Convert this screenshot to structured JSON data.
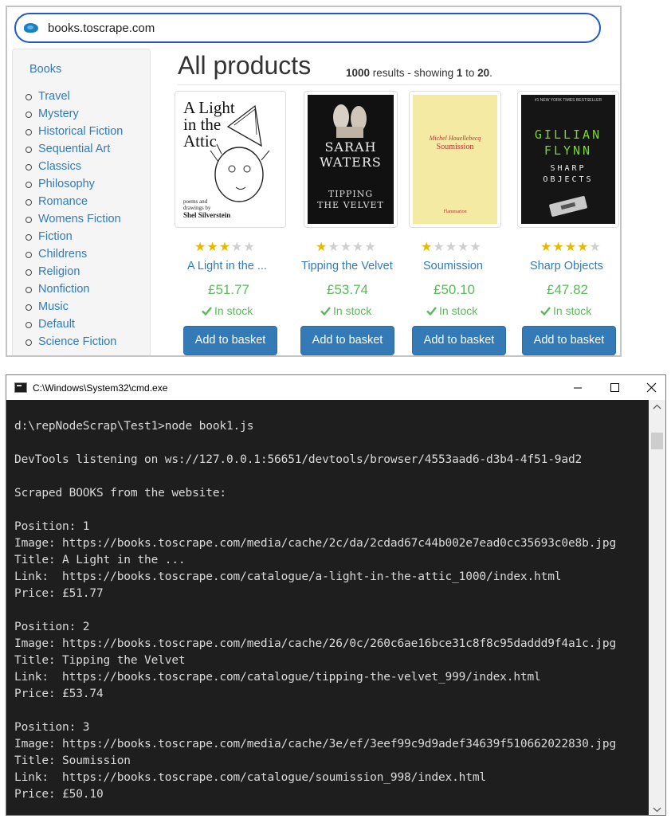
{
  "browser": {
    "url": "books.toscrape.com",
    "sidebar": {
      "title": "Books",
      "categories": [
        "Travel",
        "Mystery",
        "Historical Fiction",
        "Sequential Art",
        "Classics",
        "Philosophy",
        "Romance",
        "Womens Fiction",
        "Fiction",
        "Childrens",
        "Religion",
        "Nonfiction",
        "Music",
        "Default",
        "Science Fiction"
      ]
    },
    "page_title": "All products",
    "results": {
      "count": "1000",
      "text1": " results - showing ",
      "from": "1",
      "to_word": " to ",
      "to": "20",
      "end": "."
    },
    "products": [
      {
        "title": "A Light in the ...",
        "price": "£51.77",
        "stock": "In stock",
        "rating": 3,
        "button": "Add to basket",
        "cover": {
          "line1": "A Light",
          "line2": "in the",
          "line3": "Attic",
          "sub1": "poems and",
          "sub2": "drawings by",
          "author": "Shel Silverstein"
        }
      },
      {
        "title": "Tipping the Velvet",
        "price": "£53.74",
        "stock": "In stock",
        "rating": 1,
        "button": "Add to basket",
        "cover": {
          "author": "SARAH WATERS",
          "line1": "TIPPING",
          "line2": "THE VELVET"
        }
      },
      {
        "title": "Soumission",
        "price": "£50.10",
        "stock": "In stock",
        "rating": 1,
        "button": "Add to basket",
        "cover": {
          "author": "Michel Houellebecq",
          "line1": "Soumission",
          "publisher": "Flammarion"
        }
      },
      {
        "title": "Sharp Objects",
        "price": "£47.82",
        "stock": "In stock",
        "rating": 4,
        "button": "Add to basket",
        "cover": {
          "tag": "#1 NEW YORK TIMES BESTSELLER",
          "author1": "GILLIAN",
          "author2": "FLYNN",
          "line1": "SHARP",
          "line2": "OBJECTS"
        }
      }
    ]
  },
  "cmd": {
    "title": "C:\\Windows\\System32\\cmd.exe",
    "lines": [
      "d:\\repNodeScrap\\Test1>node book1.js",
      "",
      "DevTools listening on ws://127.0.0.1:56651/devtools/browser/4553aad6-d3b4-4f51-9ad2",
      "",
      "Scraped BOOKS from the website:",
      "",
      "Position: 1",
      "Image: https://books.toscrape.com/media/cache/2c/da/2cdad67c44b002e7ead0cc35693c0e8b.jpg",
      "Title: A Light in the ...",
      "Link:  https://books.toscrape.com/catalogue/a-light-in-the-attic_1000/index.html",
      "Price: £51.77",
      "",
      "Position: 2",
      "Image: https://books.toscrape.com/media/cache/26/0c/260c6ae16bce31c8f8c95daddd9f4a1c.jpg",
      "Title: Tipping the Velvet",
      "Link:  https://books.toscrape.com/catalogue/tipping-the-velvet_999/index.html",
      "Price: £53.74",
      "",
      "Position: 3",
      "Image: https://books.toscrape.com/media/cache/3e/ef/3eef99c9d9adef34639f510662022830.jpg",
      "Title: Soumission",
      "Link:  https://books.toscrape.com/catalogue/soumission_998/index.html",
      "Price: £50.10"
    ]
  }
}
